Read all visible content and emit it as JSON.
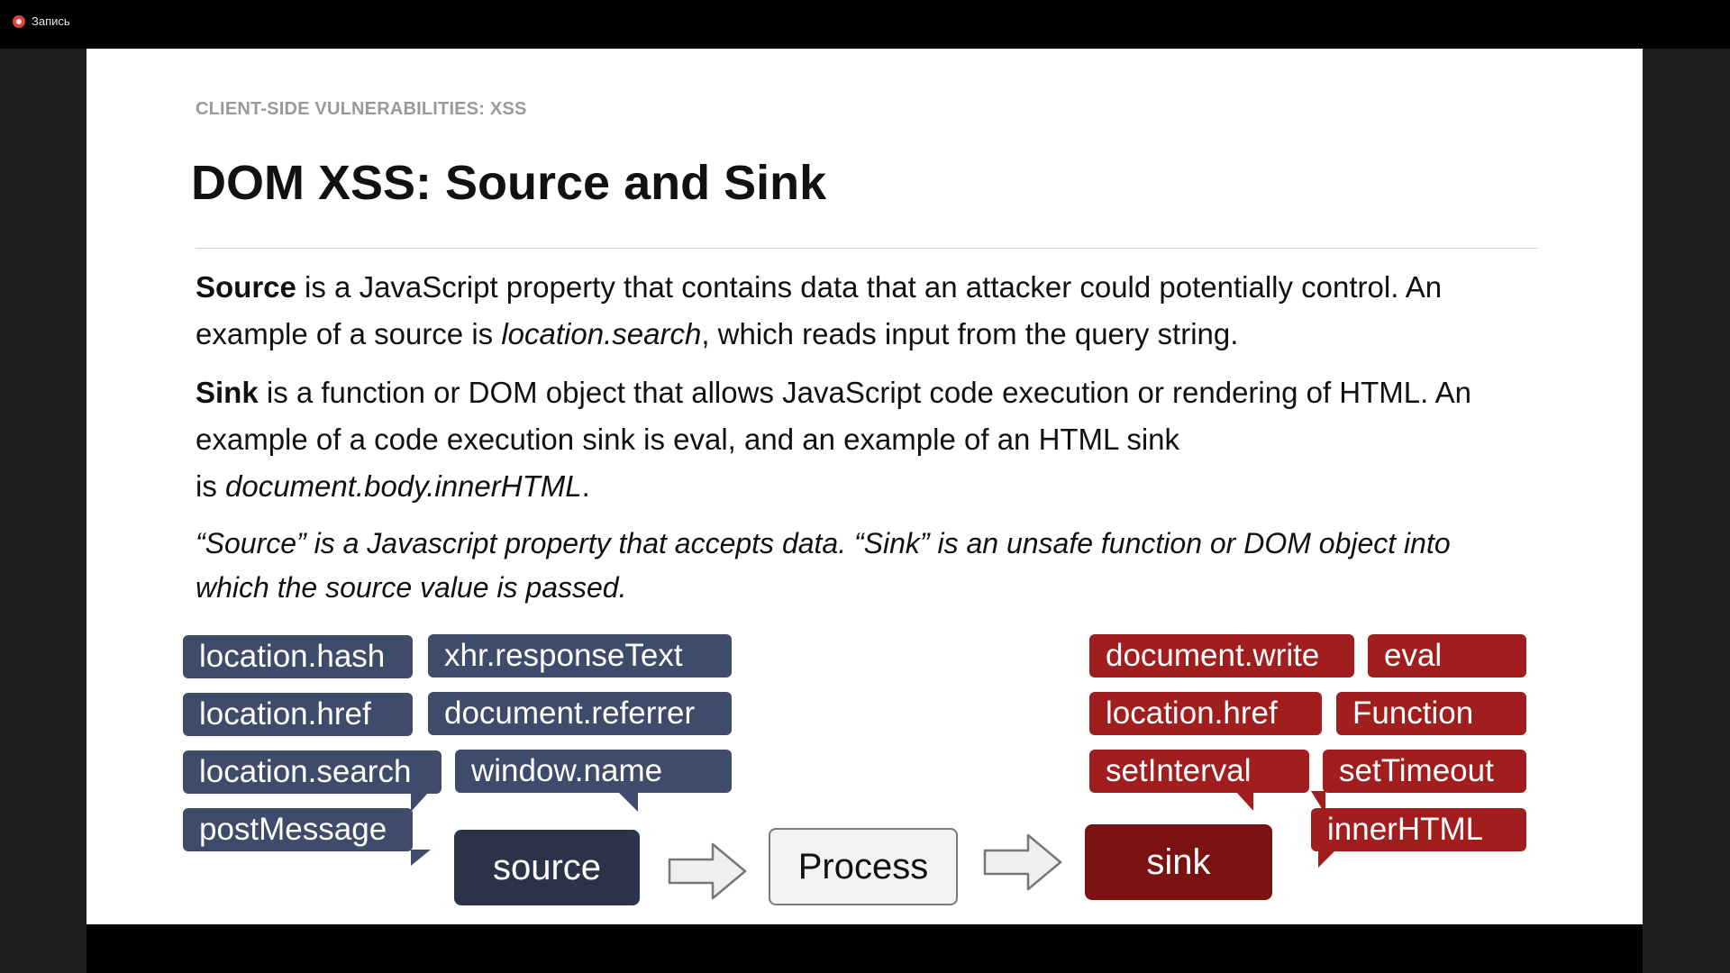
{
  "recording": {
    "label": "Запись"
  },
  "slide": {
    "eyebrow": "CLIENT-SIDE VULNERABILITIES: XSS",
    "title": "DOM XSS: Source and Sink",
    "source_para": {
      "term": "Source",
      "line1_rest": " is a JavaScript property that contains data that an attacker could potentially control. An",
      "line2_a": "example of a source is ",
      "line2_em": "location.search",
      "line2_b": ", which reads input from the query string."
    },
    "sink_para": {
      "term": "Sink",
      "line1_rest": " is a function or DOM object that allows JavaScript code execution or rendering of HTML. An",
      "line2": "example of a code execution sink is eval, and an example of an HTML sink",
      "line3_a": "is ",
      "line3_em": "document.body.innerHTML",
      "line3_b": "."
    },
    "quote": {
      "line1": "“Source” is a Javascript property that accepts data. “Sink” is an unsafe function or DOM object into",
      "line2": "which the source value is passed."
    },
    "diagram": {
      "sources": [
        "location.hash",
        "xhr.responseText",
        "location.href",
        "document.referrer",
        "location.search",
        "window.name",
        "postMessage"
      ],
      "sinks": [
        "document.write",
        "eval",
        "location.href",
        "Function",
        "setInterval",
        "setTimeout",
        "innerHTML"
      ],
      "source_box": "source",
      "process_box": "Process",
      "sink_box": "sink"
    }
  },
  "colors": {
    "source_chip": "#3e4b6b",
    "sink_chip": "#a01e1e",
    "source_box": "#2a3348",
    "sink_box": "#7c1111",
    "eyebrow": "#9a9a9a"
  }
}
